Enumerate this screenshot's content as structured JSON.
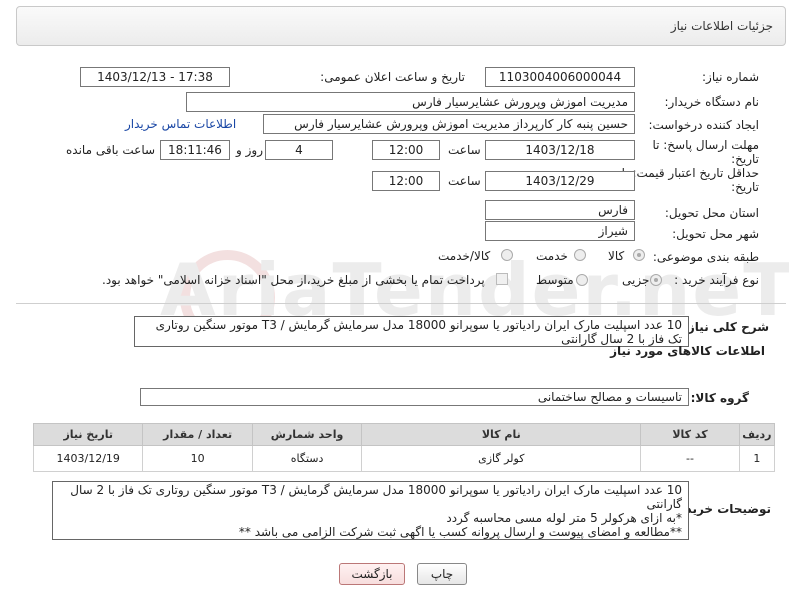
{
  "header": {
    "title": "جزئیات اطلاعات نیاز"
  },
  "watermark": "AriaTender.neT",
  "fields": {
    "need_number_label": "شماره نیاز:",
    "need_number": "1103004006000044",
    "announce_label": "تاریخ و ساعت اعلان عمومی:",
    "announce_value": "1403/12/13 - 17:38",
    "buyer_label": "نام دستگاه خریدار:",
    "buyer_value": "مدیریت اموزش وپرورش عشایرسیار فارس",
    "requester_label": "ایجاد کننده درخواست:",
    "requester_value": "حسین پنبه کار کارپرداز مدیریت اموزش وپرورش عشایرسیار فارس",
    "contact_link": "اطلاعات تماس خریدار",
    "deadline_label_line1": "مهلت ارسال پاسخ: تا",
    "deadline_label_line2": "تاریخ:",
    "deadline_date": "1403/12/18",
    "time_label": "ساعت",
    "deadline_time": "12:00",
    "days_value": "4",
    "days_label": "روز و",
    "remaining_time": "18:11:46",
    "remaining_label": "ساعت باقی مانده",
    "validity_label_line1": "حداقل تاریخ اعتبار قیمت: تا",
    "validity_label_line2": "تاریخ:",
    "validity_date": "1403/12/29",
    "validity_time": "12:00",
    "province_label": "استان محل تحویل:",
    "province_value": "فارس",
    "city_label": "شهر محل تحویل:",
    "city_value": "شیراز",
    "category_label": "طبقه بندی موضوعی:",
    "category_options": [
      "کالا",
      "خدمت",
      "کالا/خدمت"
    ],
    "process_label": "نوع فرآیند خرید :",
    "process_options": [
      "جزیی",
      "متوسط"
    ],
    "payment_note": "پرداخت تمام یا بخشی از مبلغ خرید،از محل \"اسناد خزانه اسلامی\" خواهد بود."
  },
  "general_description": {
    "label": "شرح کلی نیاز:",
    "text": "10 عدد اسپلیت مارک ایران رادیاتور یا سوپرانو  18000 مدل سرمایش گرمایش / T3  موتور سنگین روتاری تک فاز  با 2 سال گارانتی"
  },
  "goods_section": {
    "title": "اطلاعات کالاهای مورد نیاز",
    "group_label": "گروه کالا:",
    "group_value": "تاسیسات و مصالح ساختمانی"
  },
  "table": {
    "headers": [
      "ردیف",
      "کد کالا",
      "نام کالا",
      "واحد شمارش",
      "تعداد / مقدار",
      "تاریخ نیاز"
    ],
    "rows": [
      [
        "1",
        "--",
        "کولر گازی",
        "دستگاه",
        "10",
        "1403/12/19"
      ]
    ]
  },
  "buyer_notes": {
    "label": "توضیحات خریدار:",
    "line1": "10 عدد اسپلیت مارک ایران رادیاتور یا سوپرانو  18000 مدل سرمایش گرمایش / T3  موتور سنگین روتاری تک فاز  با 2 سال گارانتی",
    "line2": "*به ازای هرکولر 5 متر لوله مسی محاسبه گردد",
    "line3": "**مطالعه و امضای پیوست و ارسال پروانه کسب یا اگهی ثبت شرکت الزامی می باشد **"
  },
  "buttons": {
    "print": "چاپ",
    "back": "بازگشت"
  }
}
